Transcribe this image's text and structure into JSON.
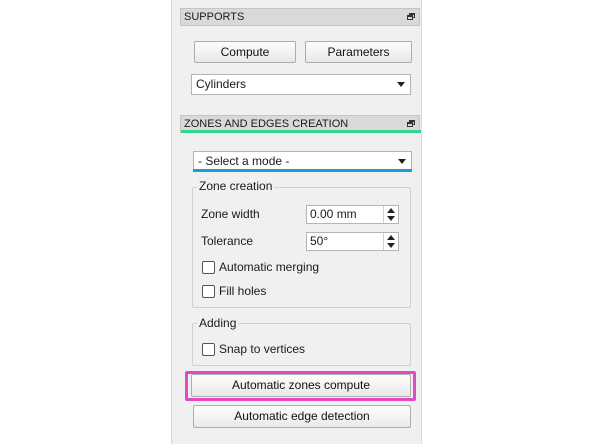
{
  "supports": {
    "title": "SUPPORTS",
    "compute_label": "Compute",
    "parameters_label": "Parameters",
    "type_selected": "Cylinders"
  },
  "zones": {
    "title": "ZONES AND EDGES CREATION",
    "mode_selected": "- Select a mode -",
    "zone_creation": {
      "title": "Zone creation",
      "zone_width_label": "Zone width",
      "zone_width_value": "0.00 mm",
      "tolerance_label": "Tolerance",
      "tolerance_value": "50°",
      "automatic_merging_label": "Automatic merging",
      "automatic_merging_checked": false,
      "fill_holes_label": "Fill holes",
      "fill_holes_checked": false
    },
    "adding": {
      "title": "Adding",
      "snap_label": "Snap to vertices",
      "snap_checked": false
    },
    "auto_zones_label": "Automatic zones compute",
    "auto_edges_label": "Automatic edge detection"
  },
  "highlights": {
    "header_underline": "#33d68a",
    "mode_underline": "#1b9be0",
    "button_frame": "#e04ac2"
  }
}
